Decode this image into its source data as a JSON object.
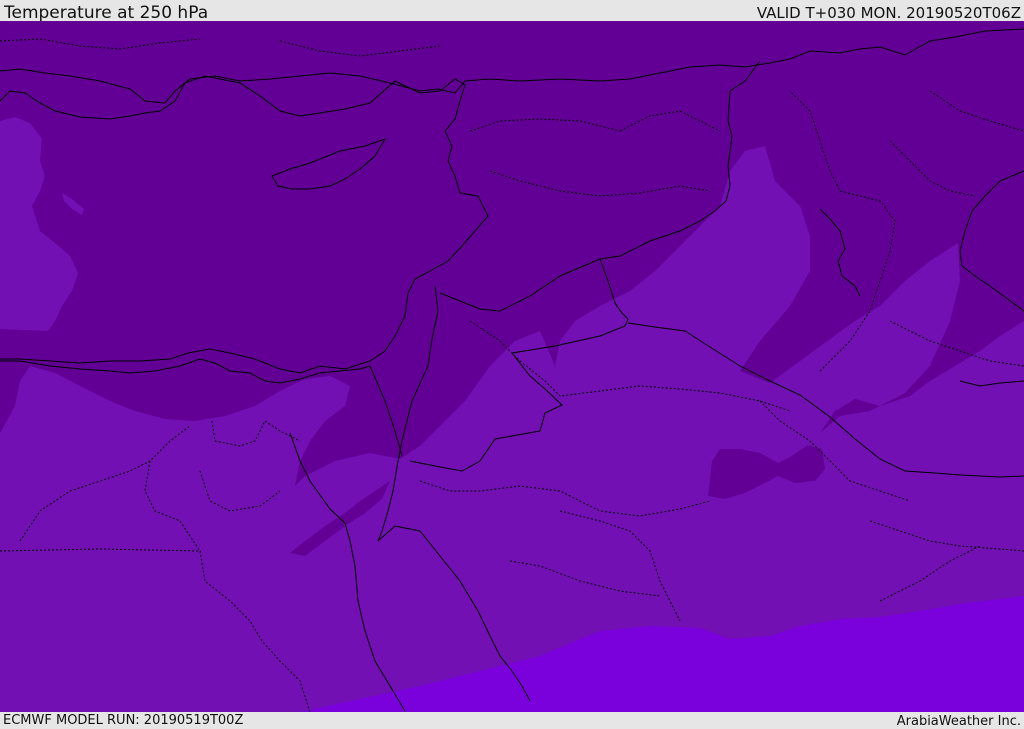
{
  "header": {
    "title": "Temperature at 250 hPa",
    "valid": "VALID T+030 MON. 20190520T06Z"
  },
  "footer": {
    "model_run": "ECMWF MODEL RUN: 20190519T00Z",
    "brand": "ArabiaWeather Inc."
  },
  "map": {
    "field": "temperature-250hPa",
    "colors": {
      "coldest": "#620096",
      "cold": "#7210b4",
      "mild": "#7a00dc",
      "coastline": "#000000"
    }
  }
}
